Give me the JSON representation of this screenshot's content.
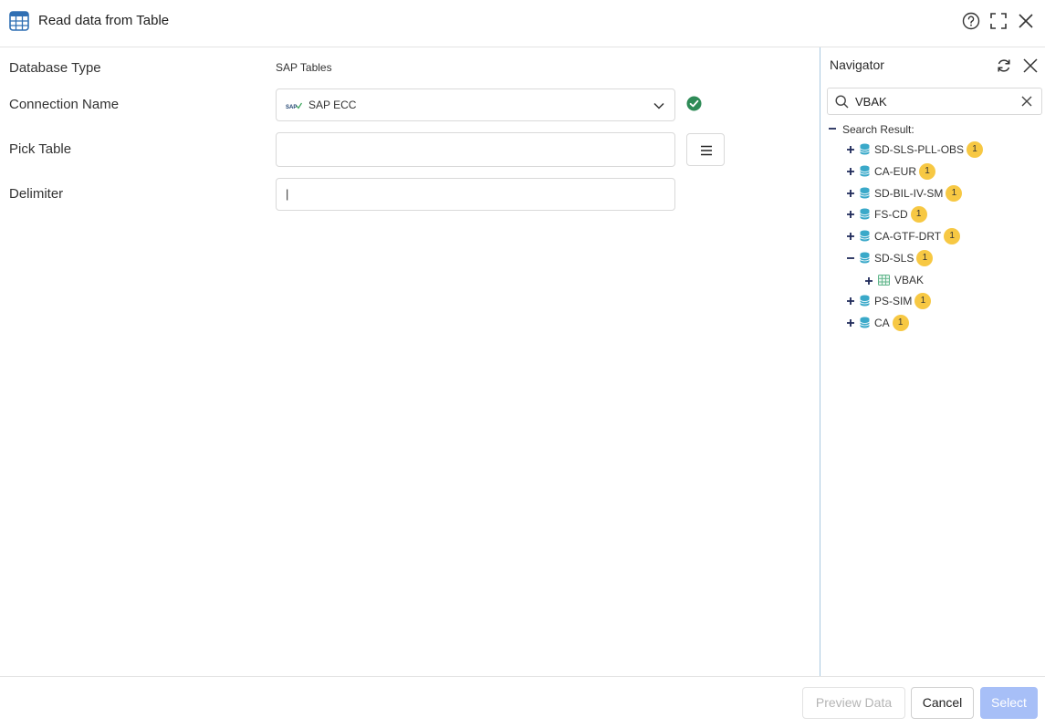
{
  "header": {
    "title": "Read data from Table",
    "icons": {
      "app": "table-grid-icon",
      "help": "help-circle-icon",
      "maximize": "maximize-icon",
      "close": "close-icon"
    }
  },
  "form": {
    "database_type": {
      "label": "Database Type",
      "value": "SAP Tables"
    },
    "connection_name": {
      "label": "Connection Name",
      "value": "SAP ECC",
      "logo_text": "SAP",
      "status": "connected",
      "status_color": "#2e8b57"
    },
    "pick_table": {
      "label": "Pick Table",
      "value": ""
    },
    "delimiter": {
      "label": "Delimiter",
      "value": "|"
    }
  },
  "navigator": {
    "title": "Navigator",
    "search": {
      "value": "VBAK"
    },
    "root_label": "Search Result:",
    "nodes": [
      {
        "label": "SD-SLS-PLL-OBS",
        "count": "1",
        "expanded": false
      },
      {
        "label": "CA-EUR",
        "count": "1",
        "expanded": false
      },
      {
        "label": "SD-BIL-IV-SM",
        "count": "1",
        "expanded": false
      },
      {
        "label": "FS-CD",
        "count": "1",
        "expanded": false
      },
      {
        "label": "CA-GTF-DRT",
        "count": "1",
        "expanded": false
      },
      {
        "label": "SD-SLS",
        "count": "1",
        "expanded": true
      },
      {
        "label": "PS-SIM",
        "count": "1",
        "expanded": false
      },
      {
        "label": "CA",
        "count": "1",
        "expanded": false
      }
    ],
    "child": {
      "label": "VBAK"
    },
    "colors": {
      "db_icon": "#3aa9c9",
      "badge": "#f7c843",
      "tree_toggle": "#1f2a5a"
    }
  },
  "footer": {
    "preview_label": "Preview Data",
    "cancel_label": "Cancel",
    "select_label": "Select"
  }
}
